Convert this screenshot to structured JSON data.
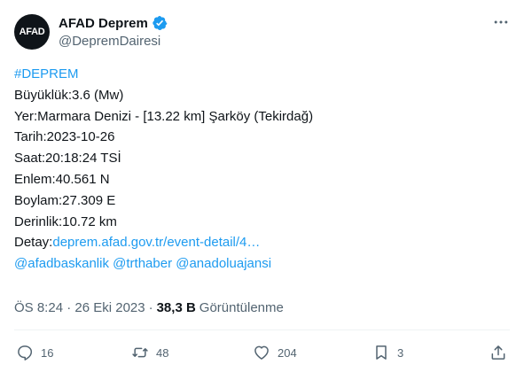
{
  "author": {
    "avatar_text": "AFAD",
    "display_name": "AFAD Deprem",
    "handle": "@DepremDairesi"
  },
  "tweet": {
    "hashtag": "#DEPREM",
    "magnitude": "Büyüklük:3.6 (Mw)",
    "location": "Yer:Marmara Denizi - [13.22 km] Şarköy (Tekirdağ)",
    "date": "Tarih:2023-10-26",
    "time": "Saat:20:18:24 TSİ",
    "latitude": "Enlem:40.561 N",
    "longitude": "Boylam:27.309 E",
    "depth": "Derinlik:10.72 km",
    "detail_label": "Detay:",
    "detail_link": "deprem.afad.gov.tr/event-detail/4…",
    "mentions": [
      "@afadbaskanlik",
      "@trthaber",
      "@anadoluajansi"
    ]
  },
  "meta": {
    "timestamp": "ÖS 8:24 · 26 Eki 2023",
    "separator": "·",
    "views_count": "38,3 B",
    "views_label": "Görüntülenme"
  },
  "actions": {
    "replies": "16",
    "retweets": "48",
    "likes": "204",
    "bookmarks": "3"
  },
  "icons": {
    "verified": "verified-badge-icon",
    "more": "more-dots-icon",
    "reply": "reply-icon",
    "retweet": "retweet-icon",
    "like": "heart-icon",
    "bookmark": "bookmark-icon",
    "share": "share-icon"
  },
  "colors": {
    "link": "#1d9bf0",
    "secondary_text": "#536471",
    "text": "#0f1419"
  }
}
